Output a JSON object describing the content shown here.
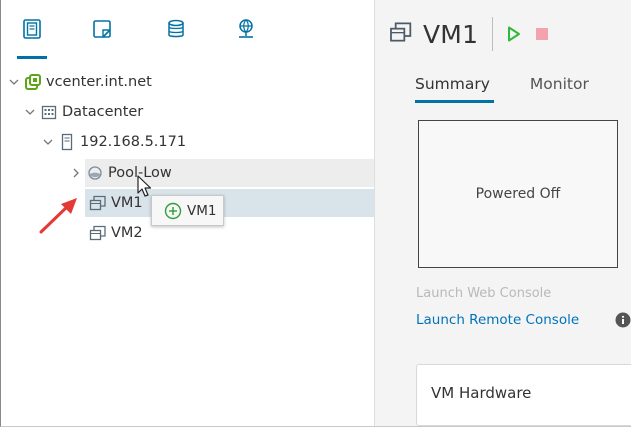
{
  "nav": {
    "tabs": [
      {
        "name": "hosts-clusters",
        "active": true
      },
      {
        "name": "vms-templates",
        "active": false
      },
      {
        "name": "storage",
        "active": false
      },
      {
        "name": "networking",
        "active": false
      }
    ]
  },
  "tree": {
    "vcenter": {
      "label": "vcenter.int.net",
      "icon": "vcenter-icon"
    },
    "datacenter": {
      "label": "Datacenter",
      "icon": "datacenter-icon"
    },
    "host": {
      "label": "192.168.5.171",
      "icon": "host-icon"
    },
    "pool": {
      "label": "Pool-Low",
      "icon": "resource-pool-icon"
    },
    "vm1": {
      "label": "VM1",
      "icon": "vm-icon"
    },
    "vm2": {
      "label": "VM2",
      "icon": "vm-icon"
    }
  },
  "drag": {
    "label": "VM1",
    "icon": "plus-circle-icon"
  },
  "header": {
    "title": "VM1",
    "power_on_icon": "play-icon",
    "power_off_icon": "stop-icon"
  },
  "tabs": [
    "Summary",
    "Monitor"
  ],
  "console": {
    "state": "Powered Off",
    "web_console": "Launch Web Console",
    "remote_console": "Launch Remote Console"
  },
  "hardware": {
    "title": "VM Hardware"
  },
  "colors": {
    "accent": "#0072a3",
    "link": "#0073b9",
    "vcenter_green": "#5ba617",
    "play_green": "#2fb83a",
    "stop_red": "#f3a3ad",
    "arrow_red": "#e53935",
    "selected_row": "#d8e3ea"
  }
}
